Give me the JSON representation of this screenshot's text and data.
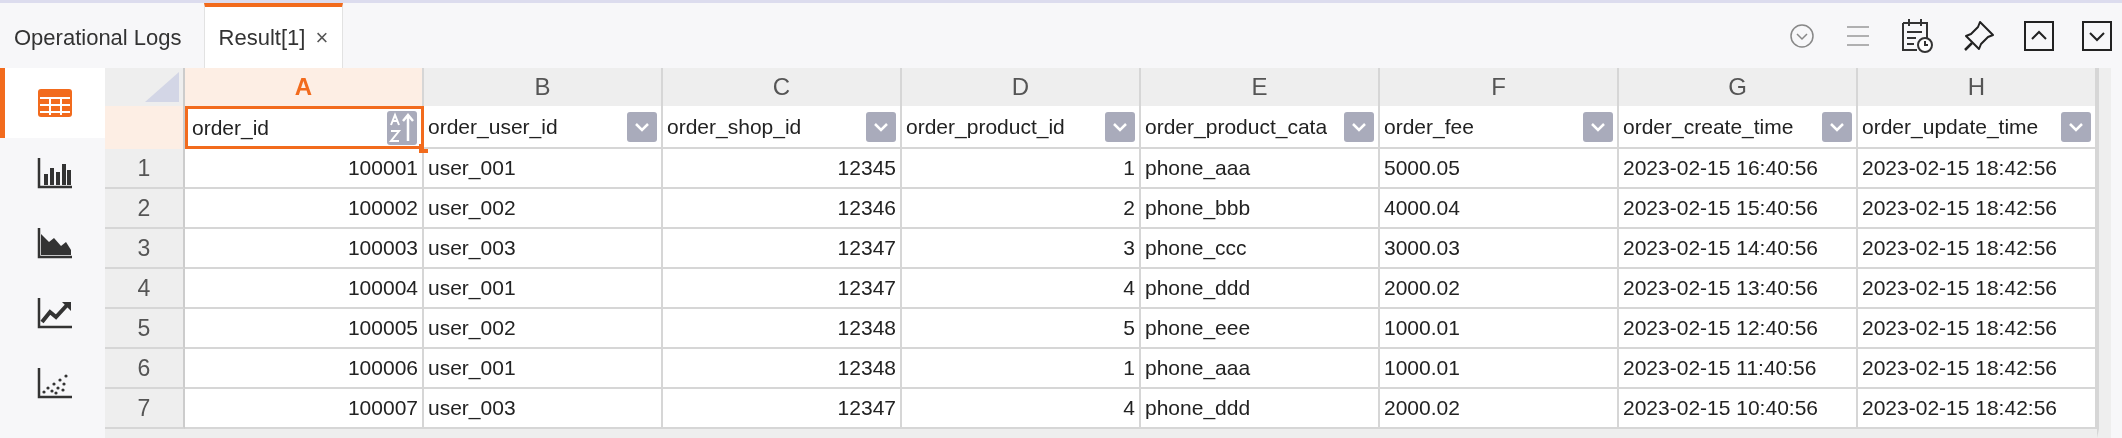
{
  "tabs": [
    {
      "label": "Operational Logs",
      "selected": false,
      "closable": false
    },
    {
      "label": "Result[1]",
      "selected": true,
      "closable": true,
      "close": "×"
    }
  ],
  "views": [
    {
      "kind": "table",
      "selected": true
    },
    {
      "kind": "bar",
      "selected": false
    },
    {
      "kind": "area",
      "selected": false
    },
    {
      "kind": "line",
      "selected": false
    },
    {
      "kind": "scatter",
      "selected": false
    }
  ],
  "columns": [
    {
      "letter": "A",
      "name": "order_id",
      "selected": true,
      "kind": "number"
    },
    {
      "letter": "B",
      "name": "order_user_id",
      "selected": false,
      "kind": "text"
    },
    {
      "letter": "C",
      "name": "order_shop_id",
      "selected": false,
      "kind": "number"
    },
    {
      "letter": "D",
      "name": "order_product_id",
      "selected": false,
      "kind": "number"
    },
    {
      "letter": "E",
      "name": "order_product_cata",
      "selected": false,
      "kind": "text"
    },
    {
      "letter": "F",
      "name": "order_fee",
      "selected": false,
      "kind": "text"
    },
    {
      "letter": "G",
      "name": "order_create_time",
      "selected": false,
      "kind": "text"
    },
    {
      "letter": "H",
      "name": "order_update_time",
      "selected": false,
      "kind": "text"
    }
  ],
  "rows": [
    {
      "number": "1",
      "cells": [
        "100001",
        "user_001",
        "12345",
        "1",
        "phone_aaa",
        "5000.05",
        "2023-02-15 16:40:56",
        "2023-02-15 18:42:56"
      ]
    },
    {
      "number": "2",
      "cells": [
        "100002",
        "user_002",
        "12346",
        "2",
        "phone_bbb",
        "4000.04",
        "2023-02-15 15:40:56",
        "2023-02-15 18:42:56"
      ]
    },
    {
      "number": "3",
      "cells": [
        "100003",
        "user_003",
        "12347",
        "3",
        "phone_ccc",
        "3000.03",
        "2023-02-15 14:40:56",
        "2023-02-15 18:42:56"
      ]
    },
    {
      "number": "4",
      "cells": [
        "100004",
        "user_001",
        "12347",
        "4",
        "phone_ddd",
        "2000.02",
        "2023-02-15 13:40:56",
        "2023-02-15 18:42:56"
      ]
    },
    {
      "number": "5",
      "cells": [
        "100005",
        "user_002",
        "12348",
        "5",
        "phone_eee",
        "1000.01",
        "2023-02-15 12:40:56",
        "2023-02-15 18:42:56"
      ]
    },
    {
      "number": "6",
      "cells": [
        "100006",
        "user_001",
        "12348",
        "1",
        "phone_aaa",
        "1000.01",
        "2023-02-15 11:40:56",
        "2023-02-15 18:42:56"
      ]
    },
    {
      "number": "7",
      "cells": [
        "100007",
        "user_003",
        "12347",
        "4",
        "phone_ddd",
        "2000.02",
        "2023-02-15 10:40:56",
        "2023-02-15 18:42:56"
      ]
    }
  ]
}
